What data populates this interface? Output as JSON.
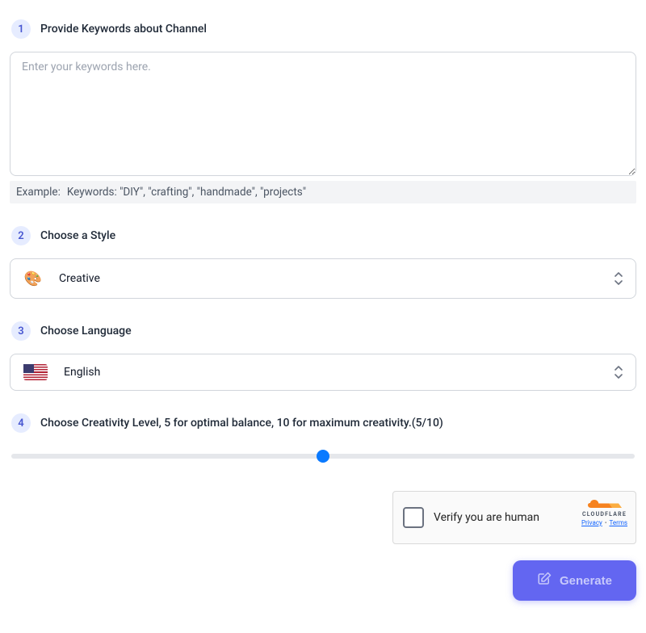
{
  "steps": {
    "s1": {
      "number": "1",
      "title": "Provide Keywords about Channel",
      "placeholder": "Enter your keywords here.",
      "value": "",
      "example_label": "Example:",
      "example_text": "Keywords: \"DIY\", \"crafting\", \"handmade\", \"projects\""
    },
    "s2": {
      "number": "2",
      "title": "Choose a Style",
      "selected": "Creative",
      "icon_glyph": "🎨"
    },
    "s3": {
      "number": "3",
      "title": "Choose Language",
      "selected": "English"
    },
    "s4": {
      "number": "4",
      "title": "Choose Creativity Level, 5 for optimal balance, 10 for maximum creativity.(5/10)",
      "min": 0,
      "max": 10,
      "value": 5
    }
  },
  "captcha": {
    "label": "Verify you are human",
    "brand": "CLOUDFLARE",
    "privacy": "Privacy",
    "terms": "Terms"
  },
  "actions": {
    "generate": "Generate"
  },
  "colors": {
    "accent": "#6366f1",
    "step_badge_bg": "#e6ecff",
    "step_badge_fg": "#4857d1",
    "slider_thumb": "#0a7aff"
  }
}
